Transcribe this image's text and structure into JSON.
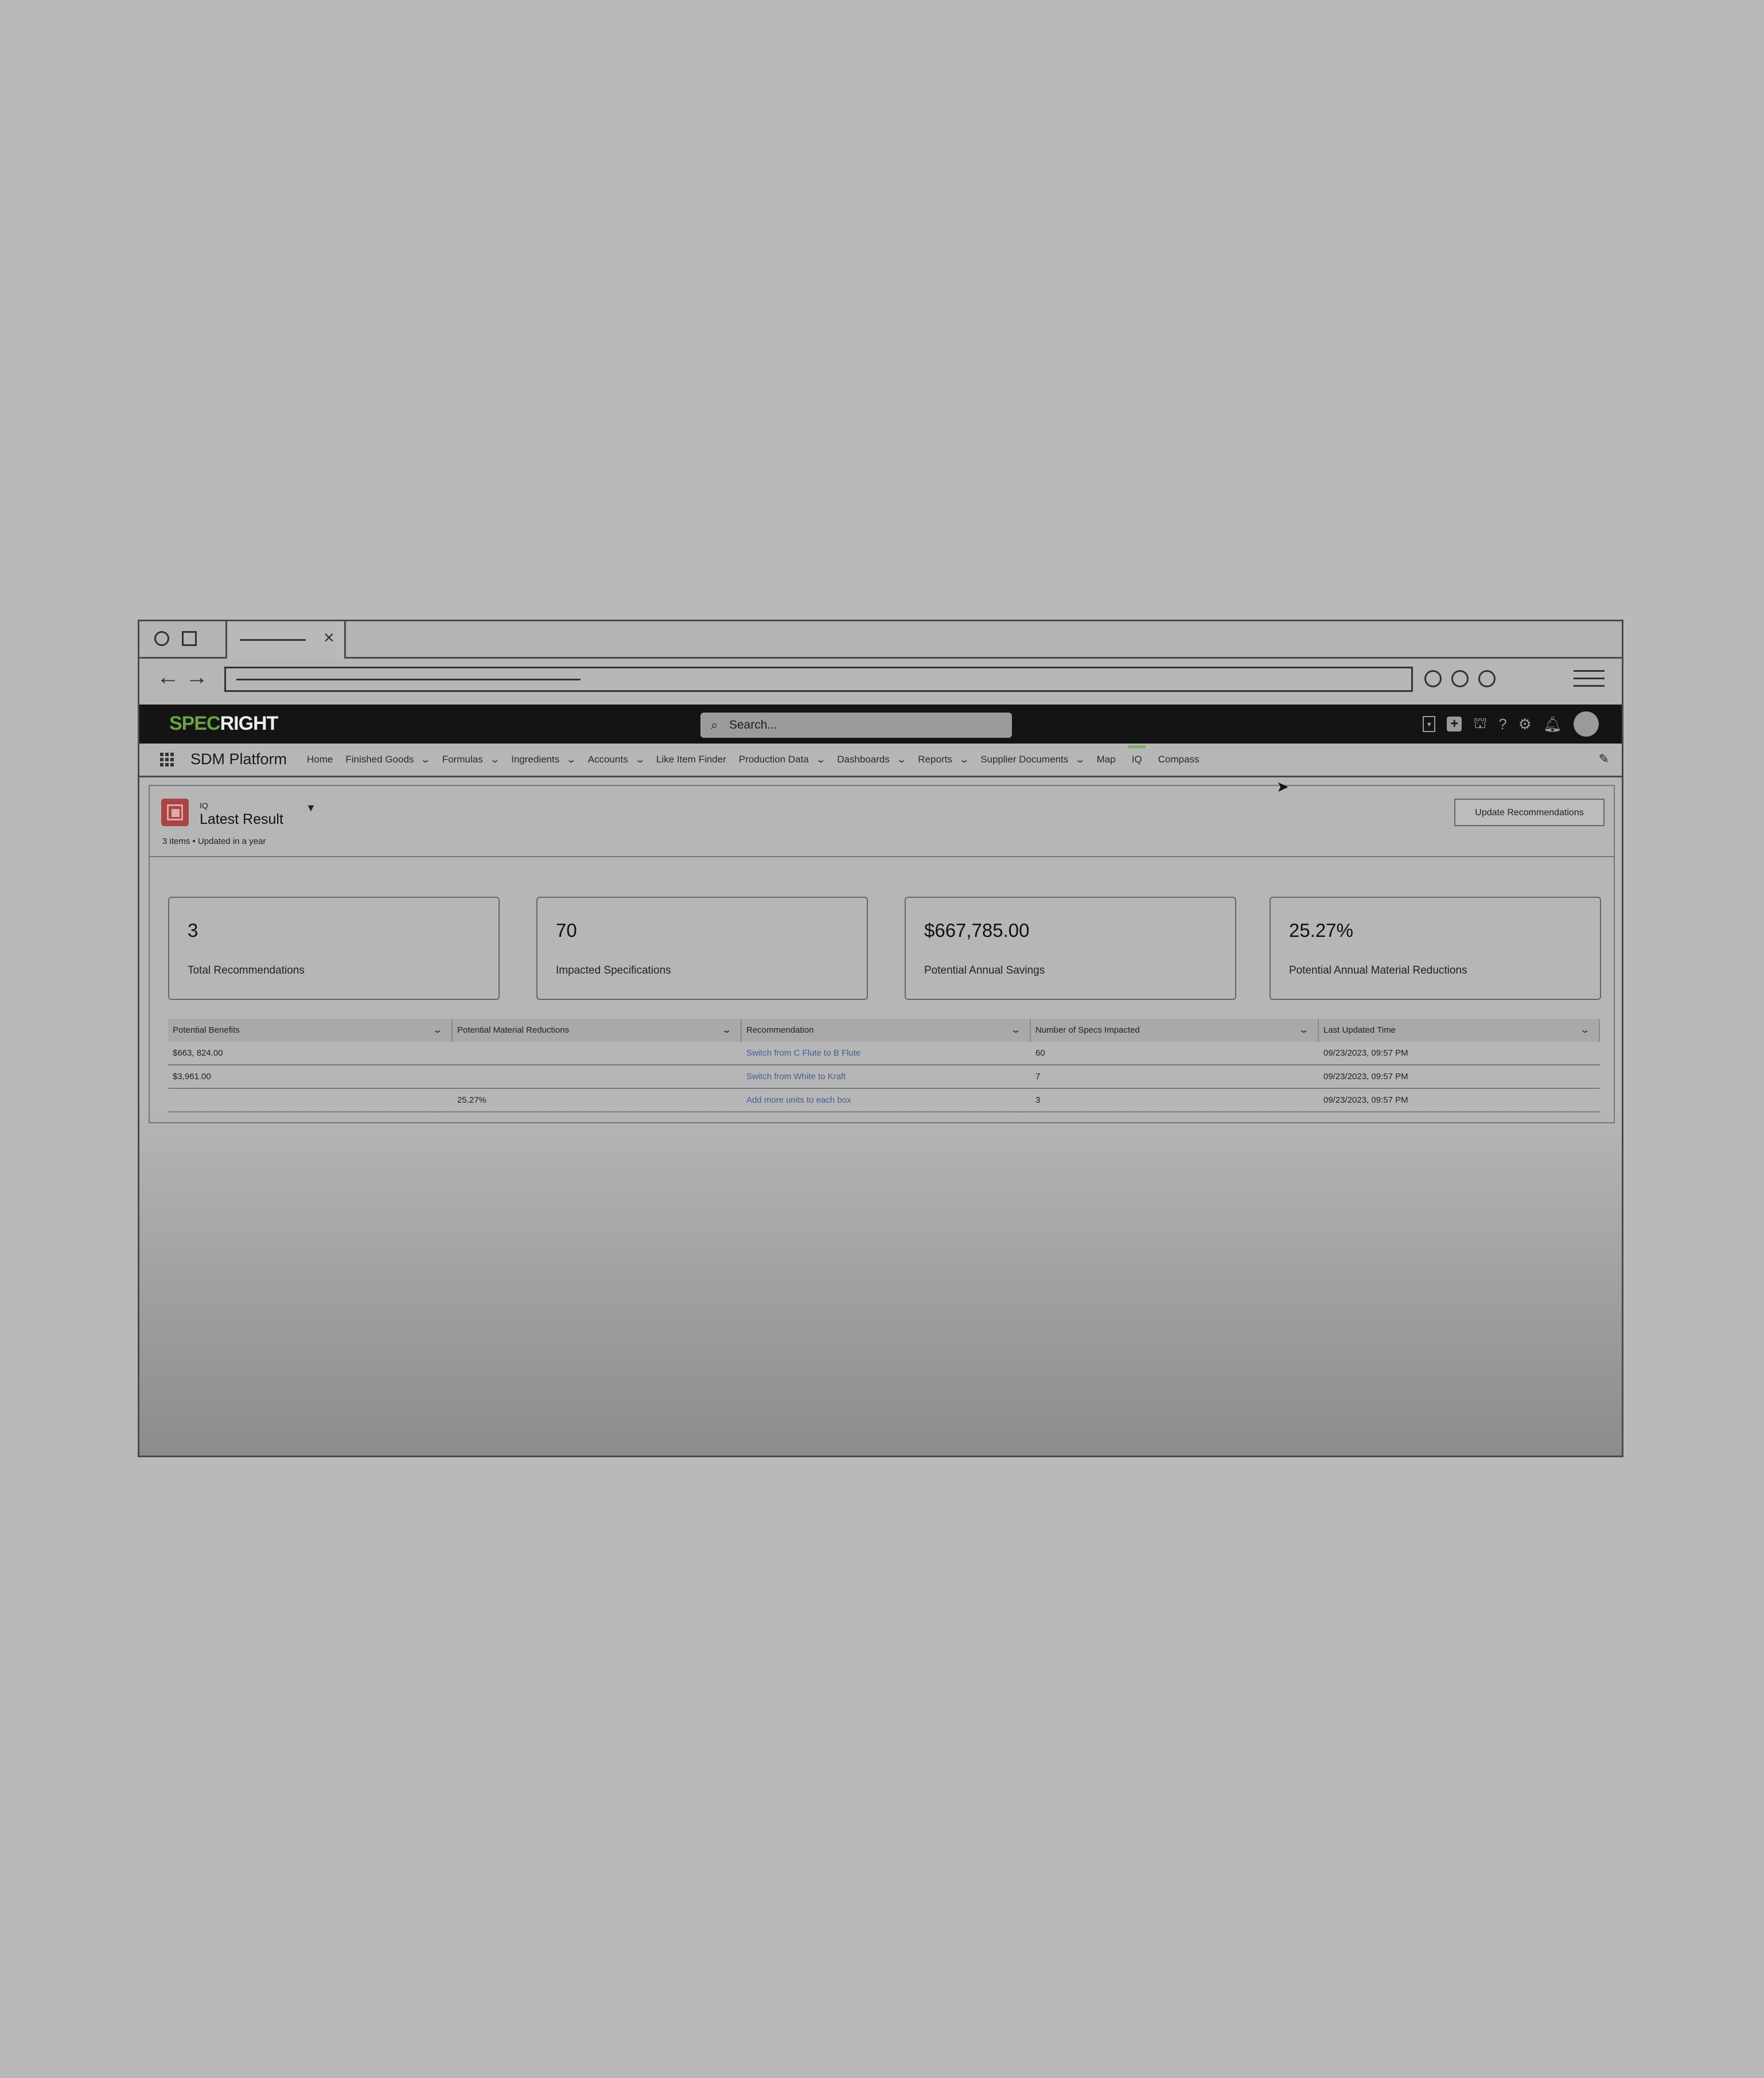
{
  "window": {
    "tab_close": "×"
  },
  "browser": {
    "back": "←",
    "forward": "→"
  },
  "header": {
    "logo_green": "SPEC",
    "logo_white": "RIGHT",
    "search_placeholder": "Search..."
  },
  "nav": {
    "app_name": "SDM Platform",
    "items": [
      {
        "label": "Home",
        "has_dropdown": false
      },
      {
        "label": "Finished Goods",
        "has_dropdown": true
      },
      {
        "label": "Formulas",
        "has_dropdown": true
      },
      {
        "label": "Ingredients",
        "has_dropdown": true
      },
      {
        "label": "Accounts",
        "has_dropdown": true
      },
      {
        "label": "Like Item Finder",
        "has_dropdown": false
      },
      {
        "label": "Production Data",
        "has_dropdown": true
      },
      {
        "label": "Dashboards",
        "has_dropdown": true
      },
      {
        "label": "Reports",
        "has_dropdown": true
      },
      {
        "label": "Supplier Documents",
        "has_dropdown": true
      },
      {
        "label": "Map",
        "has_dropdown": false
      },
      {
        "label": "IQ",
        "has_dropdown": false,
        "active": true
      },
      {
        "label": "Compass",
        "has_dropdown": false
      }
    ],
    "active_color": "#7fb06a"
  },
  "panel": {
    "object_label": "IQ",
    "title": "Latest Result",
    "meta": "3 items • Updated in a year",
    "update_button": "Update Recommendations",
    "icon_color": "#a84444"
  },
  "cards": [
    {
      "value": "3",
      "label": "Total Recommendations"
    },
    {
      "value": "70",
      "label": "Impacted Specifications"
    },
    {
      "value": "$667,785.00",
      "label": "Potential Annual Savings"
    },
    {
      "value": "25.27%",
      "label": "Potential Annual Material Reductions"
    }
  ],
  "table": {
    "columns": [
      "Potential Benefits",
      "Potential Material Reductions",
      "Recommendation",
      "Number of Specs Impacted",
      "Last Updated Time"
    ],
    "rows": [
      [
        "$663, 824.00",
        "",
        "Switch from C Flute to B Flute",
        "60",
        "09/23/2023, 09:57 PM"
      ],
      [
        "$3,961.00",
        "",
        "Switch from White to Kraft",
        "7",
        "09/23/2023, 09:57 PM"
      ],
      [
        "",
        "25.27%",
        "Add more units to each box",
        "3",
        "09/23/2023, 09:57 PM"
      ]
    ],
    "link_color": "#4a5a9a"
  }
}
